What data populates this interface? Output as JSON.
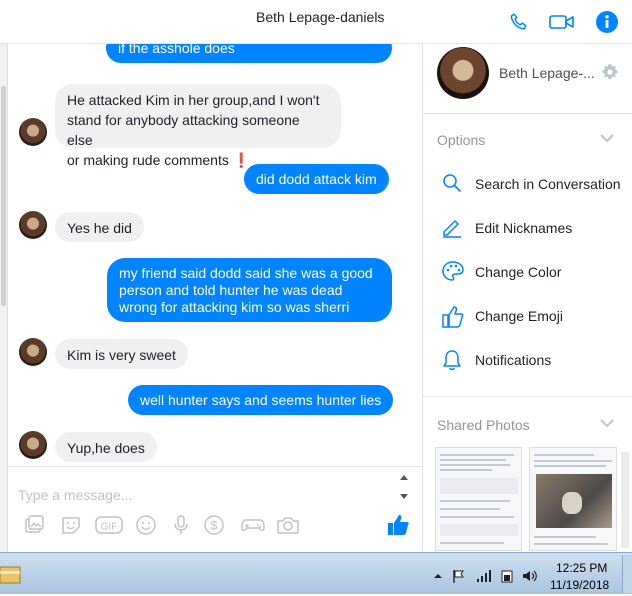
{
  "header": {
    "title": "Beth Lepage-daniels"
  },
  "messages": [
    {
      "dir": "out",
      "text": "if the asshole does"
    },
    {
      "dir": "in",
      "lines": [
        "He attacked Kim in her group,and I won't",
        "stand for anybody attacking someone else",
        "or making rude comments ❗"
      ]
    },
    {
      "dir": "out",
      "text": "did dodd attack kim"
    },
    {
      "dir": "in",
      "text": "Yes he did"
    },
    {
      "dir": "out",
      "lines": [
        "my friend said dodd said she was a good",
        "person  and told hunter he was dead",
        "wrong for attacking kim so was sherri"
      ]
    },
    {
      "dir": "in",
      "text": "Kim is very sweet"
    },
    {
      "dir": "out",
      "text": "well hunter says  and seems hunter lies"
    },
    {
      "dir": "in",
      "text": "Yup,he does"
    }
  ],
  "composer": {
    "placeholder": "Type a message..."
  },
  "composer_tools": [
    "image-icon",
    "sticker-icon",
    "gif-icon",
    "emoji-icon",
    "microphone-icon",
    "payment-icon",
    "game-controller-icon",
    "camera-icon",
    "thumbs-up-icon"
  ],
  "tool_gif_label": "GIF",
  "profile": {
    "name": "Beth Lepage-..."
  },
  "options": {
    "title": "Options",
    "items": [
      {
        "label": "Search in Conversation",
        "icon": "search-icon"
      },
      {
        "label": "Edit Nicknames",
        "icon": "pencil-icon"
      },
      {
        "label": "Change Color",
        "icon": "palette-icon"
      },
      {
        "label": "Change Emoji",
        "icon": "thumbs-up-icon"
      },
      {
        "label": "Notifications",
        "icon": "bell-icon"
      }
    ]
  },
  "shared_photos": {
    "title": "Shared Photos"
  },
  "taskbar": {
    "time": "12:25 PM",
    "date": "11/19/2018"
  },
  "colors": {
    "accent": "#0084ff",
    "incoming_bubble": "#f1f0f0",
    "alert": "#e02020"
  }
}
